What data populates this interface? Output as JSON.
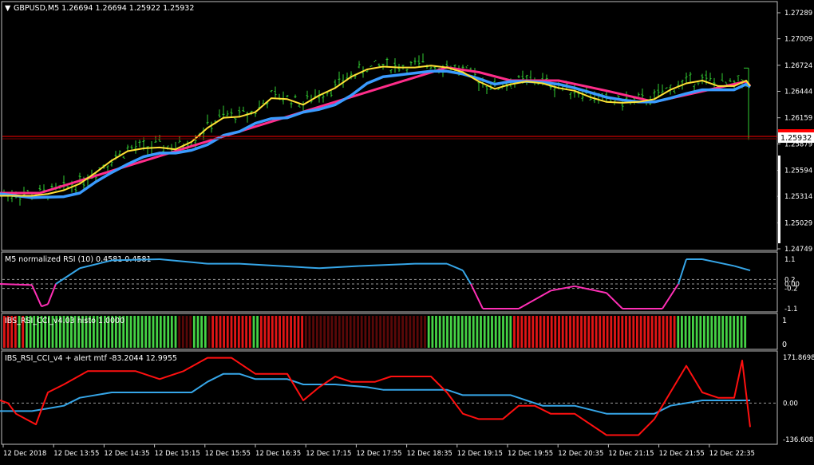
{
  "colors": {
    "background": "#000000",
    "border": "#c0c0c0",
    "candles": "#32cd32",
    "ma_fast": "#ffe135",
    "ma_slow": "#3a9bff",
    "ma_alt": "#ff2d8a",
    "bid_line": "#ff0000",
    "rsi_up": "#36a6e8",
    "rsi_down": "#ff2fb6",
    "histo_green": "#45d245",
    "histo_green_dark": "#0f6b0f",
    "histo_red": "#e01515",
    "histo_red_dark": "#5a0808",
    "cci_red": "#ff1010",
    "cci_blue": "#36a6e8",
    "level": "#9a9a9a"
  },
  "main": {
    "title": "GBPUSD,M5  1.26694  1.26694  1.25922  1.25932",
    "price_labels": [
      "1.27289",
      "1.27009",
      "1.26724",
      "1.26444",
      "1.26159",
      "1.25879",
      "1.25594",
      "1.25314",
      "1.25029",
      "1.24749"
    ],
    "current_price": "1.25932"
  },
  "rsi": {
    "title": "M5 normalized RSI (10) 0.4581 0.4581",
    "labels": [
      "1.1",
      "0.2",
      "0.00",
      "-0.2",
      "-1.1"
    ]
  },
  "histo": {
    "title": "IBS_RSI_CCI_v4.03 histo 1.0000",
    "labels": [
      "1",
      "0"
    ]
  },
  "cci": {
    "title": "IBS_RSI_CCI_v4 + alert mtf -83.2044 12.9955",
    "labels": [
      "171.8698",
      "0.00",
      "-136.6085"
    ]
  },
  "time_labels": [
    "12 Dec 2018",
    "12 Dec 13:55",
    "12 Dec 14:35",
    "12 Dec 15:15",
    "12 Dec 15:55",
    "12 Dec 16:35",
    "12 Dec 17:15",
    "12 Dec 17:55",
    "12 Dec 18:35",
    "12 Dec 19:15",
    "12 Dec 19:55",
    "12 Dec 20:35",
    "12 Dec 21:15",
    "12 Dec 21:55",
    "12 Dec 22:35"
  ],
  "chart_data": {
    "type": "line",
    "yellow_ma": [
      [
        0,
        1.2532
      ],
      [
        20,
        1.2532
      ],
      [
        40,
        1.2532
      ],
      [
        60,
        1.2534
      ],
      [
        80,
        1.2538
      ],
      [
        100,
        1.2545
      ],
      [
        120,
        1.2557
      ],
      [
        140,
        1.257
      ],
      [
        160,
        1.258
      ],
      [
        180,
        1.2583
      ],
      [
        200,
        1.2584
      ],
      [
        220,
        1.2582
      ],
      [
        240,
        1.259
      ],
      [
        260,
        1.2605
      ],
      [
        280,
        1.2616
      ],
      [
        300,
        1.2617
      ],
      [
        320,
        1.2622
      ],
      [
        340,
        1.2637
      ],
      [
        360,
        1.2636
      ],
      [
        380,
        1.263
      ],
      [
        400,
        1.264
      ],
      [
        420,
        1.2648
      ],
      [
        440,
        1.266
      ],
      [
        460,
        1.2668
      ],
      [
        480,
        1.2671
      ],
      [
        500,
        1.267
      ],
      [
        520,
        1.267
      ],
      [
        540,
        1.2672
      ],
      [
        560,
        1.267
      ],
      [
        580,
        1.2665
      ],
      [
        600,
        1.2655
      ],
      [
        620,
        1.2647
      ],
      [
        640,
        1.2652
      ],
      [
        660,
        1.2655
      ],
      [
        680,
        1.2653
      ],
      [
        700,
        1.2648
      ],
      [
        720,
        1.2645
      ],
      [
        740,
        1.2638
      ],
      [
        760,
        1.2633
      ],
      [
        780,
        1.2632
      ],
      [
        800,
        1.2633
      ],
      [
        820,
        1.2636
      ],
      [
        840,
        1.2646
      ],
      [
        860,
        1.2653
      ],
      [
        880,
        1.2656
      ],
      [
        900,
        1.265
      ],
      [
        920,
        1.265
      ],
      [
        935,
        1.2656
      ],
      [
        940,
        1.265
      ]
    ],
    "blue_ma": [
      [
        0,
        1.2534
      ],
      [
        40,
        1.253
      ],
      [
        80,
        1.2531
      ],
      [
        100,
        1.2535
      ],
      [
        120,
        1.2547
      ],
      [
        140,
        1.2557
      ],
      [
        160,
        1.2566
      ],
      [
        180,
        1.2574
      ],
      [
        200,
        1.2578
      ],
      [
        220,
        1.2578
      ],
      [
        240,
        1.2581
      ],
      [
        260,
        1.2587
      ],
      [
        280,
        1.2597
      ],
      [
        300,
        1.2601
      ],
      [
        320,
        1.261
      ],
      [
        340,
        1.2615
      ],
      [
        360,
        1.2616
      ],
      [
        380,
        1.2622
      ],
      [
        400,
        1.2625
      ],
      [
        420,
        1.263
      ],
      [
        440,
        1.264
      ],
      [
        460,
        1.2653
      ],
      [
        480,
        1.266
      ],
      [
        500,
        1.2662
      ],
      [
        520,
        1.2664
      ],
      [
        540,
        1.2666
      ],
      [
        560,
        1.2666
      ],
      [
        580,
        1.2663
      ],
      [
        600,
        1.2658
      ],
      [
        620,
        1.2652
      ],
      [
        640,
        1.2655
      ],
      [
        660,
        1.2655
      ],
      [
        680,
        1.2654
      ],
      [
        700,
        1.2652
      ],
      [
        720,
        1.2648
      ],
      [
        740,
        1.2643
      ],
      [
        760,
        1.2638
      ],
      [
        780,
        1.2635
      ],
      [
        800,
        1.2633
      ],
      [
        820,
        1.2633
      ],
      [
        840,
        1.2637
      ],
      [
        860,
        1.2642
      ],
      [
        880,
        1.2646
      ],
      [
        900,
        1.2646
      ],
      [
        920,
        1.2646
      ],
      [
        935,
        1.2652
      ],
      [
        940,
        1.2649
      ]
    ],
    "pink_ma": [
      [
        0,
        1.2535
      ],
      [
        50,
        1.2535
      ],
      [
        560,
        1.267
      ],
      [
        600,
        1.2665
      ],
      [
        640,
        1.2656
      ],
      [
        700,
        1.2656
      ],
      [
        760,
        1.2645
      ],
      [
        800,
        1.2637
      ],
      [
        820,
        1.2633
      ],
      [
        935,
        1.2655
      ],
      [
        940,
        1.265
      ]
    ],
    "rsi_line": [
      [
        0,
        0.0
      ],
      [
        40,
        -0.05
      ],
      [
        52,
        -1.0
      ],
      [
        60,
        -0.9
      ],
      [
        70,
        0.0
      ],
      [
        100,
        0.7
      ],
      [
        140,
        1.05
      ],
      [
        200,
        1.1
      ],
      [
        260,
        0.9
      ],
      [
        300,
        0.9
      ],
      [
        400,
        0.7
      ],
      [
        450,
        0.8
      ],
      [
        520,
        0.9
      ],
      [
        560,
        0.9
      ],
      [
        580,
        0.6
      ],
      [
        590,
        0.0
      ],
      [
        605,
        -1.1
      ],
      [
        650,
        -1.1
      ],
      [
        690,
        -0.3
      ],
      [
        720,
        -0.1
      ],
      [
        760,
        -0.4
      ],
      [
        780,
        -1.1
      ],
      [
        830,
        -1.1
      ],
      [
        850,
        0.0
      ],
      [
        860,
        1.1
      ],
      [
        880,
        1.1
      ],
      [
        920,
        0.8
      ],
      [
        940,
        0.6
      ]
    ],
    "histo_bars": [
      0,
      0,
      0,
      0,
      1,
      0,
      1,
      1,
      1,
      1,
      1,
      1,
      1,
      1,
      1,
      1,
      1,
      1,
      1,
      1,
      1,
      1,
      1,
      1,
      1,
      1,
      1,
      1,
      1,
      1,
      1,
      1,
      1,
      1,
      1,
      1,
      1,
      1,
      1,
      1,
      1,
      1,
      1,
      1,
      1,
      1,
      1,
      0,
      0,
      0,
      0,
      1,
      1,
      1,
      1,
      0,
      0,
      0,
      0,
      0,
      0,
      0,
      0,
      0,
      0,
      0,
      0,
      1,
      1,
      0,
      0,
      0,
      0,
      0,
      0,
      0,
      0,
      0,
      0,
      0,
      0,
      0,
      0,
      0,
      0,
      0,
      0,
      0,
      0,
      0,
      0,
      0,
      0,
      0,
      0,
      0,
      0,
      0,
      0,
      0,
      0,
      0,
      0,
      0,
      0,
      0,
      0,
      0,
      0,
      0,
      0,
      0,
      0,
      0,
      1,
      1,
      1,
      1,
      1,
      1,
      1,
      1,
      1,
      1,
      1,
      1,
      1,
      1,
      1,
      1,
      1,
      1,
      1,
      1,
      1,
      1,
      1,
      0,
      0,
      0,
      0,
      0,
      0,
      0,
      0,
      0,
      0,
      0,
      0,
      0,
      0,
      0,
      0,
      0,
      0,
      0,
      0,
      0,
      0,
      0,
      0,
      0,
      0,
      0,
      0,
      0,
      0,
      0,
      0,
      0,
      0,
      0,
      0,
      0,
      0,
      0,
      0,
      0,
      0,
      0,
      0,
      1,
      1,
      1,
      1,
      1,
      1,
      1,
      1,
      1,
      1,
      1,
      1,
      1,
      1,
      1,
      1,
      1,
      1,
      1
    ],
    "cci_red": [
      [
        0,
        10
      ],
      [
        10,
        0
      ],
      [
        20,
        -40
      ],
      [
        45,
        -80
      ],
      [
        60,
        40
      ],
      [
        80,
        70
      ],
      [
        110,
        120
      ],
      [
        140,
        120
      ],
      [
        170,
        120
      ],
      [
        200,
        90
      ],
      [
        230,
        120
      ],
      [
        260,
        170
      ],
      [
        290,
        170
      ],
      [
        320,
        110
      ],
      [
        360,
        110
      ],
      [
        380,
        10
      ],
      [
        400,
        60
      ],
      [
        420,
        100
      ],
      [
        440,
        80
      ],
      [
        470,
        80
      ],
      [
        490,
        100
      ],
      [
        540,
        100
      ],
      [
        560,
        40
      ],
      [
        580,
        -40
      ],
      [
        600,
        -60
      ],
      [
        630,
        -60
      ],
      [
        650,
        -10
      ],
      [
        670,
        -10
      ],
      [
        690,
        -40
      ],
      [
        720,
        -40
      ],
      [
        760,
        -120
      ],
      [
        800,
        -120
      ],
      [
        820,
        -60
      ],
      [
        840,
        40
      ],
      [
        860,
        140
      ],
      [
        880,
        40
      ],
      [
        900,
        20
      ],
      [
        920,
        20
      ],
      [
        930,
        160
      ],
      [
        940,
        -90
      ]
    ],
    "cci_blue": [
      [
        0,
        -30
      ],
      [
        40,
        -30
      ],
      [
        60,
        -20
      ],
      [
        80,
        -10
      ],
      [
        100,
        20
      ],
      [
        140,
        40
      ],
      [
        200,
        40
      ],
      [
        240,
        40
      ],
      [
        260,
        80
      ],
      [
        280,
        110
      ],
      [
        300,
        110
      ],
      [
        320,
        90
      ],
      [
        360,
        90
      ],
      [
        380,
        70
      ],
      [
        420,
        70
      ],
      [
        460,
        60
      ],
      [
        480,
        50
      ],
      [
        560,
        50
      ],
      [
        580,
        30
      ],
      [
        640,
        30
      ],
      [
        680,
        -10
      ],
      [
        720,
        -10
      ],
      [
        760,
        -40
      ],
      [
        820,
        -40
      ],
      [
        840,
        -10
      ],
      [
        860,
        0
      ],
      [
        880,
        10
      ],
      [
        920,
        10
      ],
      [
        940,
        10
      ]
    ]
  }
}
